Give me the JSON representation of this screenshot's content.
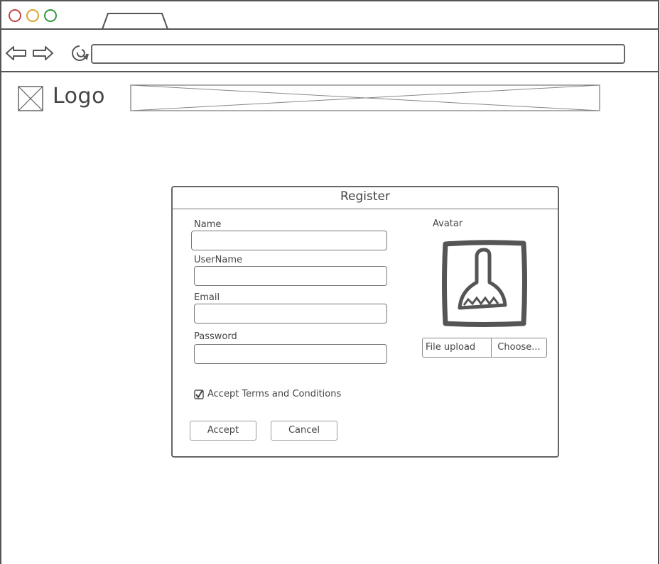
{
  "browser": {
    "traffic_lights": [
      {
        "name": "close",
        "color": "#c0474a"
      },
      {
        "name": "minimize",
        "color": "#d9a42c"
      },
      {
        "name": "maximize",
        "color": "#2f9a3a"
      }
    ],
    "url": ""
  },
  "header": {
    "logo_text": "Logo"
  },
  "dialog": {
    "title": "Register",
    "fields": {
      "name_label": "Name",
      "username_label": "UserName",
      "email_label": "Email",
      "password_label": "Password"
    },
    "avatar_label": "Avatar",
    "upload": {
      "label": "File upload",
      "button": "Choose..."
    },
    "terms": {
      "label": "Accept Terms and Conditions",
      "checked": true
    },
    "buttons": {
      "accept": "Accept",
      "cancel": "Cancel"
    }
  }
}
